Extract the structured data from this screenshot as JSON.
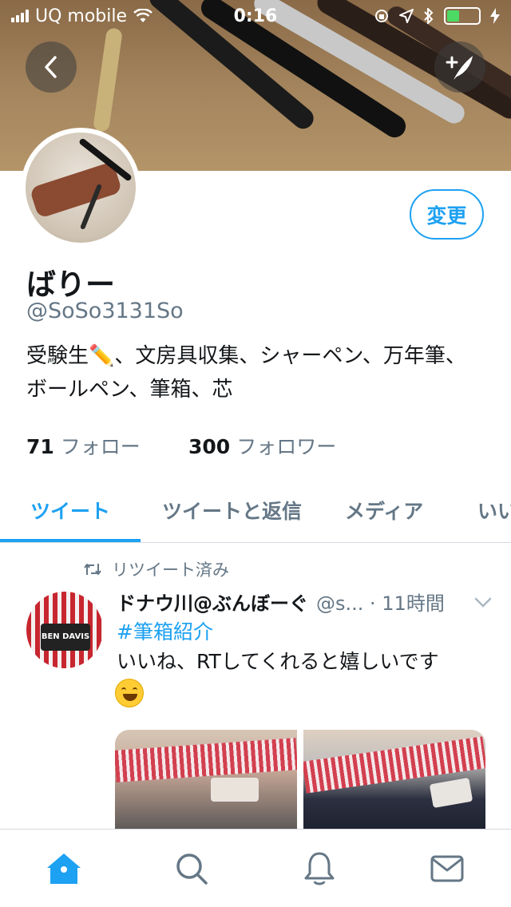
{
  "status_bar": {
    "carrier": "UQ mobile",
    "time": "0:16"
  },
  "profile": {
    "edit_label": "変更",
    "name": "ばりー",
    "handle": "@SoSo3131So",
    "bio": "受験生✏️、文房具収集、シャーペン、万年筆、ボールペン、筆箱、芯",
    "following_count": "71",
    "following_label": "フォロー",
    "followers_count": "300",
    "followers_label": "フォロワー"
  },
  "tabs": [
    {
      "label": "ツイート",
      "active": true
    },
    {
      "label": "ツイートと返信",
      "active": false
    },
    {
      "label": "メディア",
      "active": false
    },
    {
      "label": "いい",
      "active": false
    }
  ],
  "tweet": {
    "retweet_label": "リツイート済み",
    "user_name": "ドナウ川@ぶんぼーぐ",
    "meta": "@s... · 11時間",
    "hashtag": "#筆箱紹介",
    "text": "いいね、RTしてくれると嬉しいです",
    "avatar_text": "BEN DAVIS"
  },
  "colors": {
    "accent": "#1da1f2",
    "secondary_text": "#657786"
  },
  "icons": {
    "back": "chevron-left-icon",
    "compose": "compose-feather-icon",
    "retweet": "retweet-icon",
    "home": "home-icon",
    "search": "search-icon",
    "notifications": "bell-icon",
    "messages": "mail-icon"
  }
}
